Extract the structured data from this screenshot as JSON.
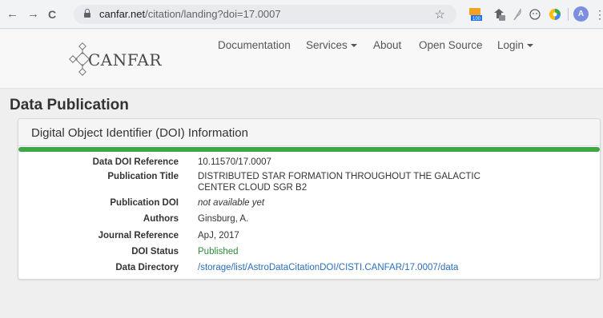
{
  "browser": {
    "back": "←",
    "forward": "→",
    "reload": "C",
    "url_host": "canfar.net",
    "url_path": "/citation/landing?doi=17.0007",
    "star": "☆",
    "ext_badge": "100",
    "profile_initial": "A",
    "menu": "⋮"
  },
  "site": {
    "logo_text": "CANFAR",
    "nav": {
      "documentation": "Documentation",
      "services": "Services",
      "about": "About",
      "open_source": "Open Source",
      "login": "Login"
    }
  },
  "page": {
    "title": "Data Publication",
    "panel_title": "Digital Object Identifier (DOI) Information",
    "progress_percent": 100,
    "fields": [
      {
        "label": "Data DOI Reference",
        "value": "10.11570/17.0007"
      },
      {
        "label": "Publication Title",
        "value": "DISTRIBUTED STAR FORMATION THROUGHOUT THE GALACTIC CENTER CLOUD SGR B2"
      },
      {
        "label": "Publication DOI",
        "value": "not available yet"
      },
      {
        "label": "Authors",
        "value": "Ginsburg, A."
      },
      {
        "label": "Journal Reference",
        "value": "ApJ, 2017"
      },
      {
        "label": "DOI Status",
        "value": "Published"
      },
      {
        "label": "Data Directory",
        "value": "/storage/list/AstroDataCitationDOI/CISTI.CANFAR/17.0007/data"
      }
    ]
  },
  "colors": {
    "progress": "#3fa745",
    "status_published": "#2e8b3a",
    "link": "#2a6ebb"
  }
}
